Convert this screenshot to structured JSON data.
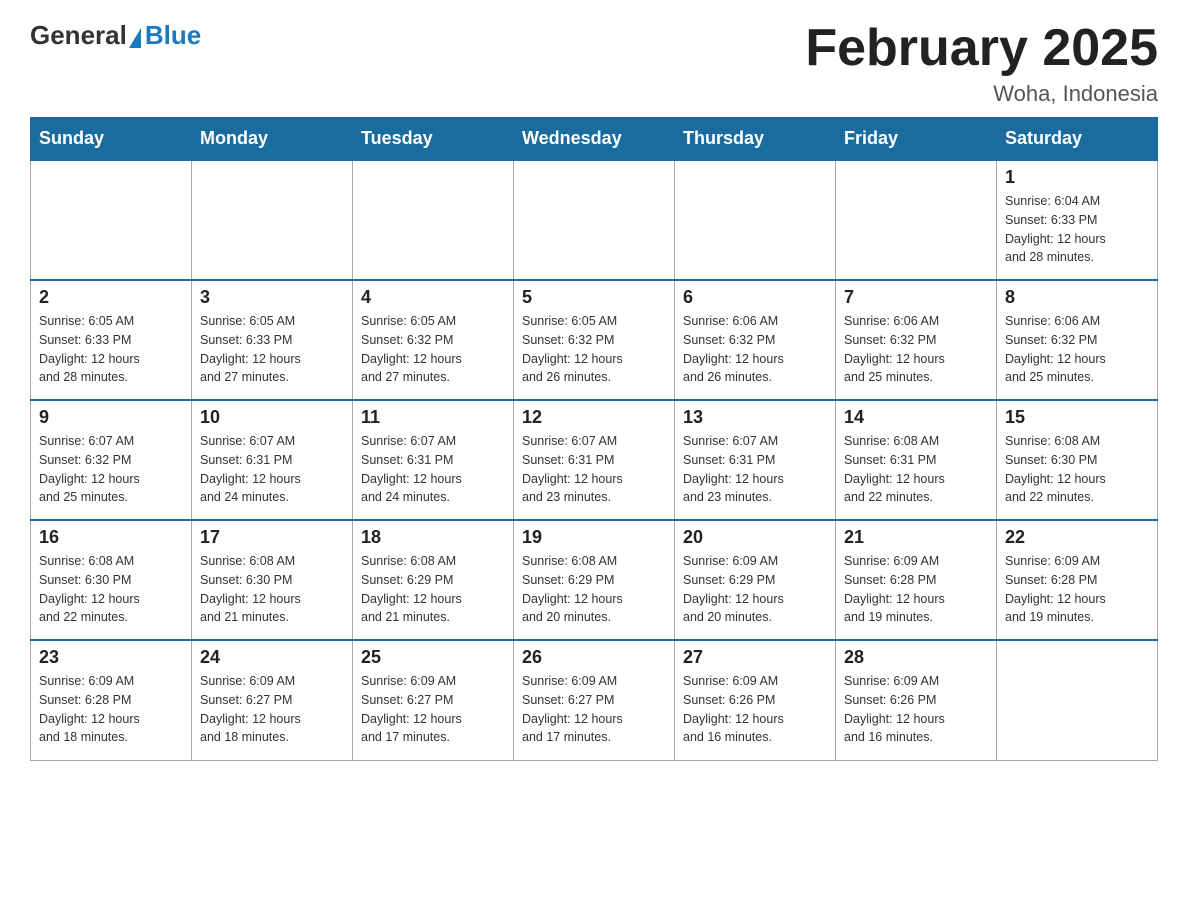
{
  "header": {
    "logo": {
      "general": "General",
      "blue": "Blue"
    },
    "title": "February 2025",
    "subtitle": "Woha, Indonesia"
  },
  "days_of_week": [
    "Sunday",
    "Monday",
    "Tuesday",
    "Wednesday",
    "Thursday",
    "Friday",
    "Saturday"
  ],
  "weeks": [
    [
      {
        "day": "",
        "info": ""
      },
      {
        "day": "",
        "info": ""
      },
      {
        "day": "",
        "info": ""
      },
      {
        "day": "",
        "info": ""
      },
      {
        "day": "",
        "info": ""
      },
      {
        "day": "",
        "info": ""
      },
      {
        "day": "1",
        "info": "Sunrise: 6:04 AM\nSunset: 6:33 PM\nDaylight: 12 hours\nand 28 minutes."
      }
    ],
    [
      {
        "day": "2",
        "info": "Sunrise: 6:05 AM\nSunset: 6:33 PM\nDaylight: 12 hours\nand 28 minutes."
      },
      {
        "day": "3",
        "info": "Sunrise: 6:05 AM\nSunset: 6:33 PM\nDaylight: 12 hours\nand 27 minutes."
      },
      {
        "day": "4",
        "info": "Sunrise: 6:05 AM\nSunset: 6:32 PM\nDaylight: 12 hours\nand 27 minutes."
      },
      {
        "day": "5",
        "info": "Sunrise: 6:05 AM\nSunset: 6:32 PM\nDaylight: 12 hours\nand 26 minutes."
      },
      {
        "day": "6",
        "info": "Sunrise: 6:06 AM\nSunset: 6:32 PM\nDaylight: 12 hours\nand 26 minutes."
      },
      {
        "day": "7",
        "info": "Sunrise: 6:06 AM\nSunset: 6:32 PM\nDaylight: 12 hours\nand 25 minutes."
      },
      {
        "day": "8",
        "info": "Sunrise: 6:06 AM\nSunset: 6:32 PM\nDaylight: 12 hours\nand 25 minutes."
      }
    ],
    [
      {
        "day": "9",
        "info": "Sunrise: 6:07 AM\nSunset: 6:32 PM\nDaylight: 12 hours\nand 25 minutes."
      },
      {
        "day": "10",
        "info": "Sunrise: 6:07 AM\nSunset: 6:31 PM\nDaylight: 12 hours\nand 24 minutes."
      },
      {
        "day": "11",
        "info": "Sunrise: 6:07 AM\nSunset: 6:31 PM\nDaylight: 12 hours\nand 24 minutes."
      },
      {
        "day": "12",
        "info": "Sunrise: 6:07 AM\nSunset: 6:31 PM\nDaylight: 12 hours\nand 23 minutes."
      },
      {
        "day": "13",
        "info": "Sunrise: 6:07 AM\nSunset: 6:31 PM\nDaylight: 12 hours\nand 23 minutes."
      },
      {
        "day": "14",
        "info": "Sunrise: 6:08 AM\nSunset: 6:31 PM\nDaylight: 12 hours\nand 22 minutes."
      },
      {
        "day": "15",
        "info": "Sunrise: 6:08 AM\nSunset: 6:30 PM\nDaylight: 12 hours\nand 22 minutes."
      }
    ],
    [
      {
        "day": "16",
        "info": "Sunrise: 6:08 AM\nSunset: 6:30 PM\nDaylight: 12 hours\nand 22 minutes."
      },
      {
        "day": "17",
        "info": "Sunrise: 6:08 AM\nSunset: 6:30 PM\nDaylight: 12 hours\nand 21 minutes."
      },
      {
        "day": "18",
        "info": "Sunrise: 6:08 AM\nSunset: 6:29 PM\nDaylight: 12 hours\nand 21 minutes."
      },
      {
        "day": "19",
        "info": "Sunrise: 6:08 AM\nSunset: 6:29 PM\nDaylight: 12 hours\nand 20 minutes."
      },
      {
        "day": "20",
        "info": "Sunrise: 6:09 AM\nSunset: 6:29 PM\nDaylight: 12 hours\nand 20 minutes."
      },
      {
        "day": "21",
        "info": "Sunrise: 6:09 AM\nSunset: 6:28 PM\nDaylight: 12 hours\nand 19 minutes."
      },
      {
        "day": "22",
        "info": "Sunrise: 6:09 AM\nSunset: 6:28 PM\nDaylight: 12 hours\nand 19 minutes."
      }
    ],
    [
      {
        "day": "23",
        "info": "Sunrise: 6:09 AM\nSunset: 6:28 PM\nDaylight: 12 hours\nand 18 minutes."
      },
      {
        "day": "24",
        "info": "Sunrise: 6:09 AM\nSunset: 6:27 PM\nDaylight: 12 hours\nand 18 minutes."
      },
      {
        "day": "25",
        "info": "Sunrise: 6:09 AM\nSunset: 6:27 PM\nDaylight: 12 hours\nand 17 minutes."
      },
      {
        "day": "26",
        "info": "Sunrise: 6:09 AM\nSunset: 6:27 PM\nDaylight: 12 hours\nand 17 minutes."
      },
      {
        "day": "27",
        "info": "Sunrise: 6:09 AM\nSunset: 6:26 PM\nDaylight: 12 hours\nand 16 minutes."
      },
      {
        "day": "28",
        "info": "Sunrise: 6:09 AM\nSunset: 6:26 PM\nDaylight: 12 hours\nand 16 minutes."
      },
      {
        "day": "",
        "info": ""
      }
    ]
  ]
}
